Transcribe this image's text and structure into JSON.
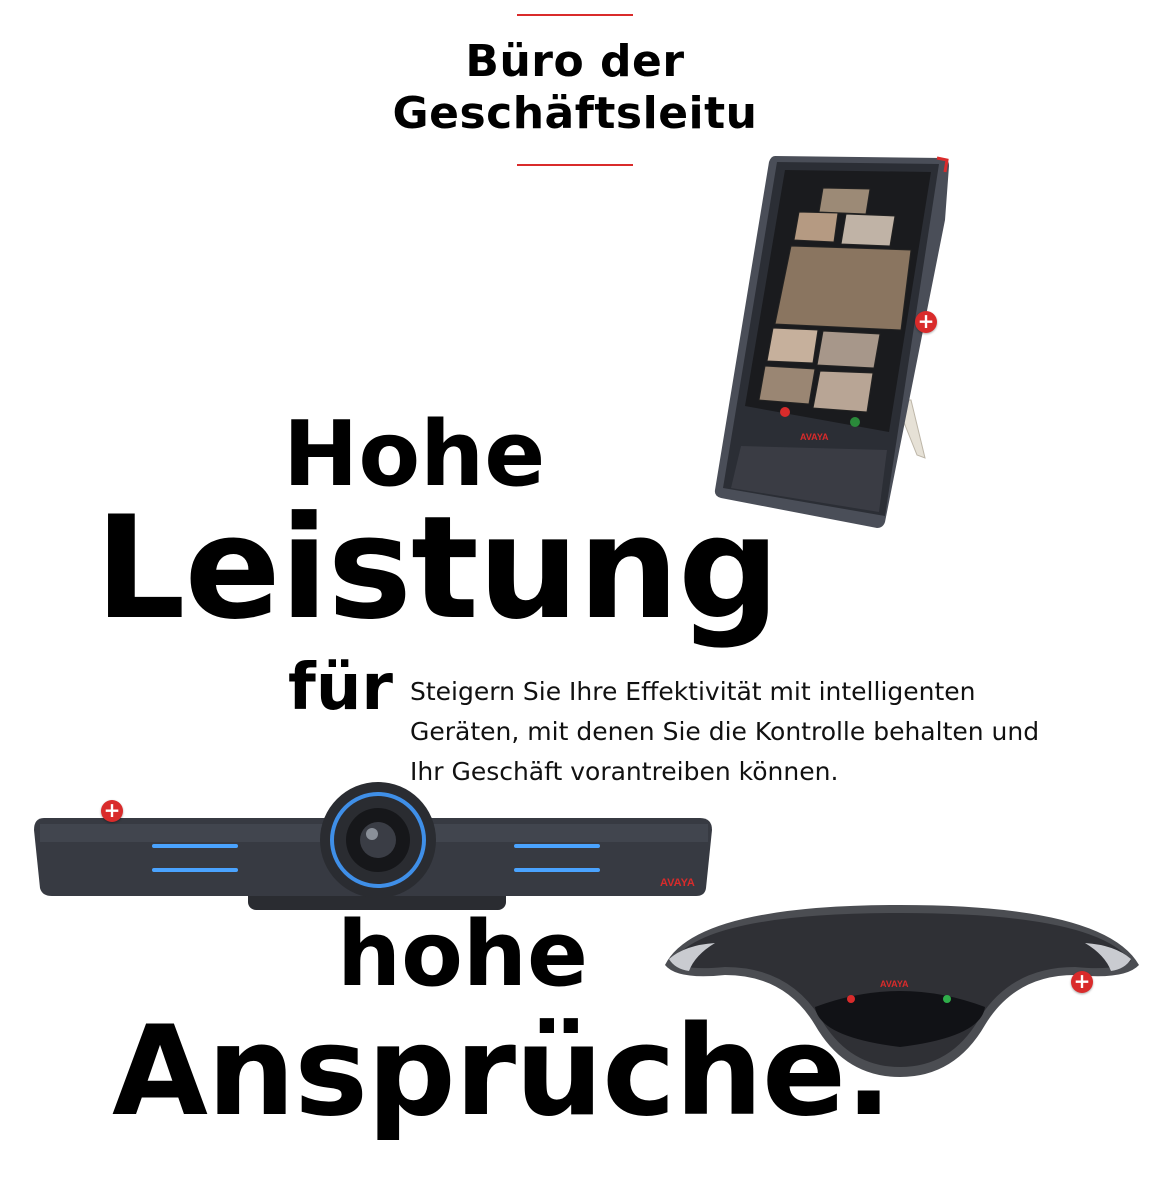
{
  "header": {
    "title_line1": "Büro der",
    "title_line2": "Geschäftsleitu"
  },
  "headline": {
    "word1": "Hohe",
    "word2": "Leistung",
    "word3": "für",
    "word4": "hohe",
    "word5": "Ansprüche."
  },
  "description": "Steigern Sie Ihre Effektivität mit intelligenten Geräten, mit denen Sie die Kontrolle behalten und Ihr Geschäft vorantreiben können.",
  "hotspot_symbol": "+",
  "products": {
    "tablet": {
      "brand": "AVAYA",
      "icon": "video-conferencing-tablet"
    },
    "camera": {
      "brand": "AVAYA",
      "icon": "conference-camera-bar"
    },
    "speakerphone": {
      "brand": "AVAYA",
      "icon": "conference-speakerphone"
    }
  },
  "colors": {
    "accent": "#d92b2b",
    "text": "#000000",
    "device": "#3a3d45"
  }
}
